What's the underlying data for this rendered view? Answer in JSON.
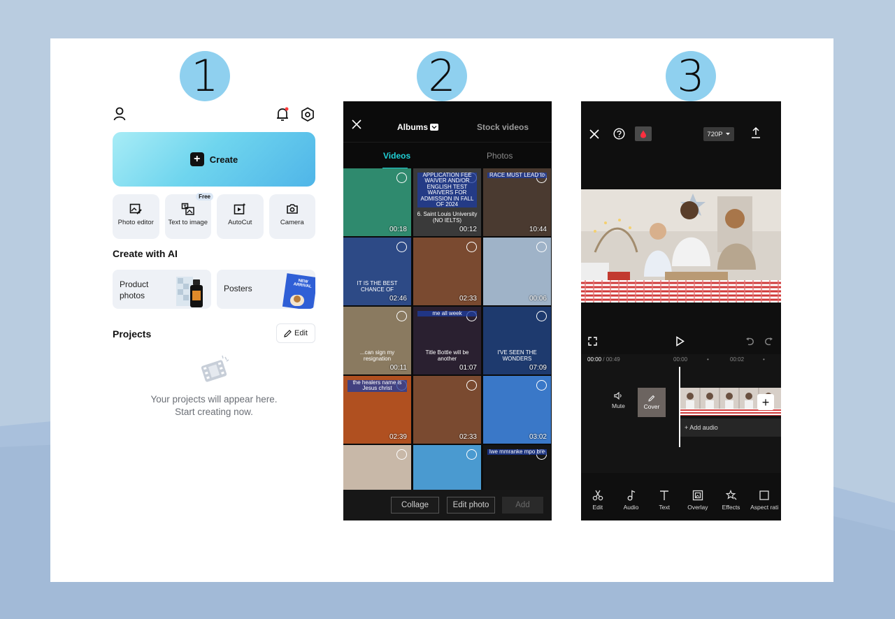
{
  "steps": [
    "1",
    "2",
    "3"
  ],
  "panel1": {
    "create_label": "Create",
    "tools": [
      {
        "label": "Photo editor",
        "icon": "photo-edit-icon"
      },
      {
        "label": "Text to image",
        "icon": "text-to-image-icon",
        "badge": "Free"
      },
      {
        "label": "AutoCut",
        "icon": "autocut-icon"
      },
      {
        "label": "Camera",
        "icon": "camera-icon"
      }
    ],
    "create_with_ai": "Create with AI",
    "ai_cards": [
      {
        "label": "Product photos"
      },
      {
        "label": "Posters",
        "art_text": "NEW ARRIVAL"
      }
    ],
    "projects_title": "Projects",
    "edit_label": "Edit",
    "empty_line1": "Your projects will appear here.",
    "empty_line2": "Start creating now."
  },
  "panel2": {
    "albums_label": "Albums",
    "stock_label": "Stock videos",
    "tab_videos": "Videos",
    "tab_photos": "Photos",
    "accent": "#20d0d6",
    "tiles": [
      {
        "dur": "00:18",
        "bg": "#2f8a6e"
      },
      {
        "dur": "00:12",
        "bg": "#3a3a3a",
        "caption_top": "APPLICATION FEE WAIVER AND/OR ENGLISH TEST WAIVERS FOR ADMISSION IN FALL OF 2024",
        "caption_bottom": "6. Saint Louis University (NO IELTS)"
      },
      {
        "dur": "10:44",
        "bg": "#4a3a30",
        "caption_top": "RACE MUST LEAD to"
      },
      {
        "dur": "02:46",
        "bg": "#2d4a86",
        "caption_bottom": "IT IS THE BEST CHANCE OF"
      },
      {
        "dur": "02:33",
        "bg": "#7a4a30"
      },
      {
        "dur": "00:06",
        "bg": "#9fb3c8"
      },
      {
        "dur": "00:11",
        "bg": "#8a7a60",
        "caption_bottom": "...can sign my resignation"
      },
      {
        "dur": "01:07",
        "bg": "#2a2030",
        "caption_top": "me all week",
        "caption_bottom": "Title Bottle will be another"
      },
      {
        "dur": "07:09",
        "bg": "#1e3a6e",
        "caption_bottom": "I'VE SEEN THE WONDERS"
      },
      {
        "dur": "02:39",
        "bg": "#b05020",
        "caption_top": "the healers name is Jesus christ"
      },
      {
        "dur": "02:33",
        "bg": "#7a4a30"
      },
      {
        "dur": "03:02",
        "bg": "#3a78c8"
      },
      {
        "dur": "",
        "bg": "#c8b8a8"
      },
      {
        "dur": "",
        "bg": "#4a9ad0"
      },
      {
        "dur": "",
        "bg": "#151515",
        "caption_top": "lwe mmranke mpo bre"
      }
    ],
    "btn_collage": "Collage",
    "btn_edit_photo": "Edit photo",
    "btn_add": "Add"
  },
  "panel3": {
    "resolution": "720P",
    "time_current": "00:00",
    "time_total": "/ 00:49",
    "tick1": "00:00",
    "tick2": "00:02",
    "mute_label": "Mute",
    "cover_label": "Cover",
    "add_audio": "+ Add audio",
    "tools": [
      {
        "label": "Edit",
        "icon": "scissors-icon"
      },
      {
        "label": "Audio",
        "icon": "music-note-icon"
      },
      {
        "label": "Text",
        "icon": "text-icon"
      },
      {
        "label": "Overlay",
        "icon": "overlay-icon"
      },
      {
        "label": "Effects",
        "icon": "effects-icon"
      },
      {
        "label": "Aspect rati",
        "icon": "aspect-ratio-icon"
      }
    ]
  }
}
